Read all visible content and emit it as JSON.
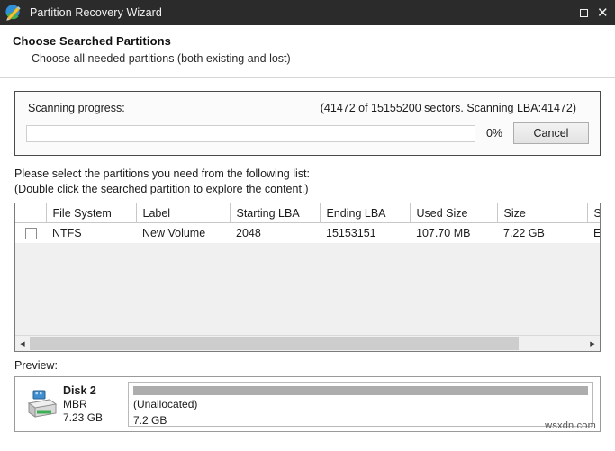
{
  "window": {
    "title": "Partition Recovery Wizard",
    "icon": "wizard-wand-icon",
    "maximize_label": "",
    "close_label": "✕",
    "titlebar_color": "#2b2b2b"
  },
  "header": {
    "title": "Choose Searched Partitions",
    "subtitle": "Choose all needed partitions (both existing and lost)"
  },
  "progress": {
    "label": "Scanning progress:",
    "status": "(41472 of 15155200 sectors. Scanning LBA:41472)",
    "percent_label": "0%",
    "percent_value": 0,
    "cancel_label": "Cancel",
    "sectors_done": 41472,
    "sectors_total": 15155200,
    "current_lba": 41472
  },
  "instructions": {
    "line1": "Please select the partitions you need from the following list:",
    "line2": "(Double click the searched partition to explore the content.)"
  },
  "table": {
    "columns": [
      "",
      "File System",
      "Label",
      "Starting LBA",
      "Ending LBA",
      "Used Size",
      "Size",
      "Status"
    ],
    "rows": [
      {
        "checked": false,
        "file_system": "NTFS",
        "label": "New Volume",
        "starting_lba": "2048",
        "ending_lba": "15153151",
        "used_size": "107.70 MB",
        "size": "7.22 GB",
        "status": "Existing"
      }
    ],
    "scroll_left_arrow": "◀",
    "scroll_right_arrow": "▶"
  },
  "preview": {
    "label": "Preview:",
    "disk": {
      "icon": "usb-hard-disk-icon",
      "name": "Disk 2",
      "scheme": "MBR",
      "capacity": "7.23 GB"
    },
    "partitions": [
      {
        "name": "(Unallocated)",
        "size": "7.2 GB",
        "color": "#adadad",
        "width_percent": 100
      }
    ]
  },
  "watermark": "wsxdn.com"
}
